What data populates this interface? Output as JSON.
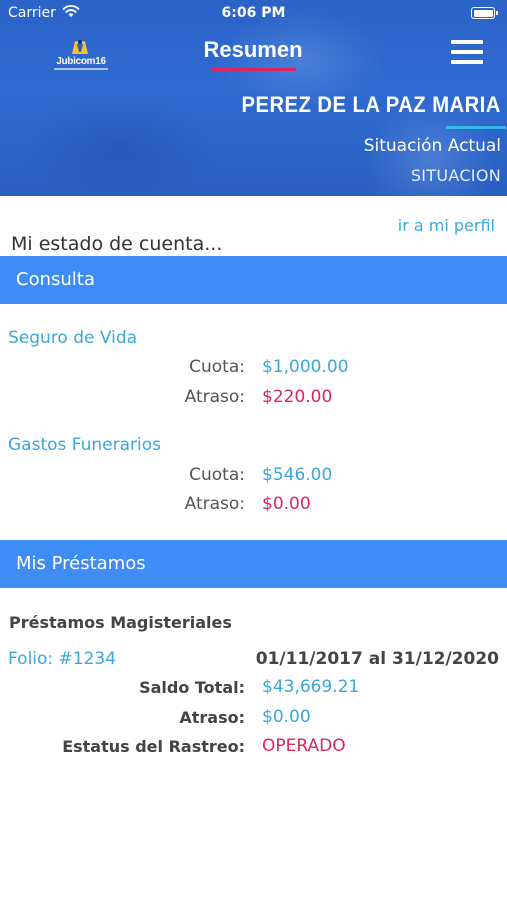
{
  "status_bar": {
    "carrier": "Carrier",
    "time": "6:06 PM",
    "wifi_icon": "wifi-icon",
    "battery_icon": "battery-icon"
  },
  "header": {
    "logo_text": "Jubicom16",
    "title": "Resumen",
    "menu_icon": "hamburger-menu-icon",
    "user_name": "PEREZ DE LA PAZ MARIA",
    "situation_label": "Situación Actual",
    "situation_value": "SITUACION"
  },
  "profile_link": "ir a mi perfil",
  "account_title": "Mi estado de cuenta...",
  "consulta": {
    "section_title": "Consulta",
    "items": [
      {
        "title": "Seguro de Vida",
        "cuota_label": "Cuota:",
        "cuota_value": "$1,000.00",
        "atraso_label": "Atraso:",
        "atraso_value": "$220.00"
      },
      {
        "title": "Gastos Funerarios",
        "cuota_label": "Cuota:",
        "cuota_value": "$546.00",
        "atraso_label": "Atraso:",
        "atraso_value": "$0.00"
      }
    ]
  },
  "prestamos": {
    "section_title": "Mis Préstamos",
    "loan_type": "Préstamos Magisteriales",
    "folio": "Folio: #1234",
    "date_range": "01/11/2017 al 31/12/2020",
    "saldo_label": "Saldo Total:",
    "saldo_value": "$43,669.21",
    "atraso_label": "Atraso:",
    "atraso_value": "$0.00",
    "estatus_label": "Estatus del Rastreo:",
    "estatus_value": "OPERADO"
  },
  "colors": {
    "header_blue": "#2f6ad0",
    "section_blue": "#3f8cf5",
    "accent_pink": "#e0245e",
    "link_blue": "#3aa7db"
  }
}
